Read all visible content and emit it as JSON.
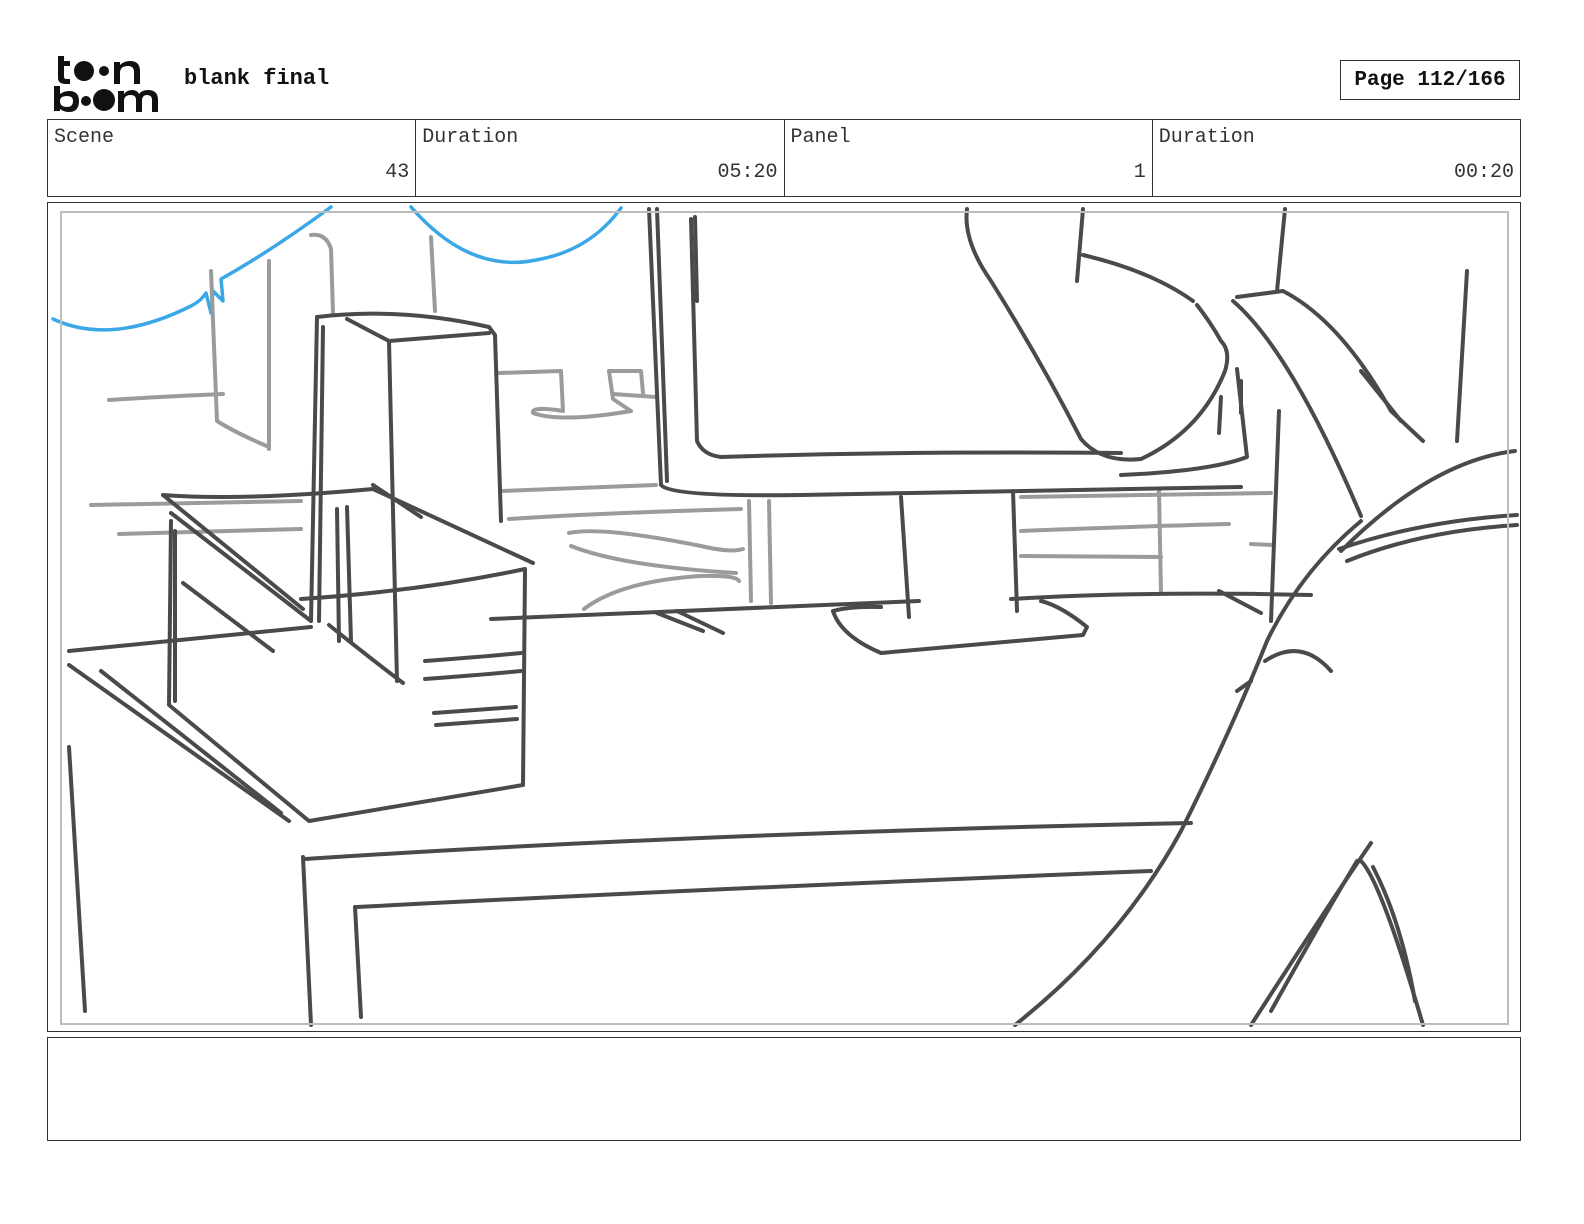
{
  "header": {
    "logo_text": "toon boom",
    "project_title": "blank final",
    "page_indicator": "Page 112/166"
  },
  "info": {
    "scene_label": "Scene",
    "scene_value": "43",
    "scene_duration_label": "Duration",
    "scene_duration_value": "05:20",
    "panel_label": "Panel",
    "panel_value": "1",
    "panel_duration_label": "Duration",
    "panel_duration_value": "00:20"
  },
  "panel": {
    "sketch": "office desk with printer, monitor and chair",
    "colors": {
      "dark_stroke": "#4a4a4a",
      "light_stroke": "#9b9b9b",
      "blue_stroke": "#3aa7e6"
    }
  },
  "notes": {
    "text": ""
  }
}
